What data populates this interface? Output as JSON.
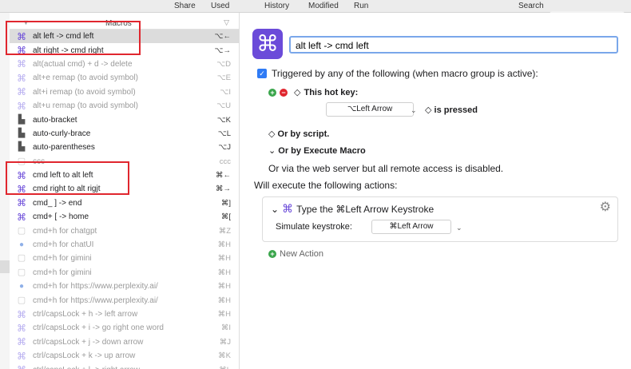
{
  "toolbar": {
    "share": "Share",
    "used": "Used",
    "history": "History",
    "modified": "Modified",
    "run": "Run",
    "search": "Search"
  },
  "macros": {
    "title": "Macros",
    "items": [
      {
        "name": "alt left -> cmd left",
        "key": "⌥←",
        "icon": "keyboard-maestro-icon",
        "dim": false,
        "selected": true
      },
      {
        "name": "alt right -> cmd right",
        "key": "⌥→",
        "icon": "keyboard-maestro-icon",
        "dim": false,
        "selected": false
      },
      {
        "name": "alt(actual cmd) + d -> delete",
        "key": "⌥D",
        "icon": "keyboard-maestro-icon",
        "dim": true,
        "selected": false
      },
      {
        "name": "alt+e remap (to avoid symbol)",
        "key": "⌥E",
        "icon": "keyboard-maestro-icon",
        "dim": true,
        "selected": false
      },
      {
        "name": "alt+i remap (to avoid symbol)",
        "key": "⌥I",
        "icon": "keyboard-maestro-icon",
        "dim": true,
        "selected": false
      },
      {
        "name": "alt+u remap (to avoid symbol)",
        "key": "⌥U",
        "icon": "keyboard-maestro-icon",
        "dim": true,
        "selected": false
      },
      {
        "name": "auto-bracket",
        "key": "⌥K",
        "icon": "app-icon",
        "dim": false,
        "selected": false
      },
      {
        "name": "auto-curly-brace",
        "key": "⌥L",
        "icon": "app-icon",
        "dim": false,
        "selected": false
      },
      {
        "name": "auto-parentheses",
        "key": "⌥J",
        "icon": "app-icon",
        "dim": false,
        "selected": false
      },
      {
        "name": "ccc",
        "key": "ccc",
        "icon": "grey-icon",
        "dim": true,
        "selected": false
      },
      {
        "name": "cmd left to alt left",
        "key": "⌘←",
        "icon": "keyboard-maestro-icon",
        "dim": false,
        "selected": false
      },
      {
        "name": "cmd right to alt rigjt",
        "key": "⌘→",
        "icon": "keyboard-maestro-icon",
        "dim": false,
        "selected": false
      },
      {
        "name": "cmd_ ] -> end",
        "key": "⌘]",
        "icon": "keyboard-maestro-icon",
        "dim": false,
        "selected": false
      },
      {
        "name": "cmd+ [ -> home",
        "key": "⌘[",
        "icon": "keyboard-maestro-icon",
        "dim": false,
        "selected": false
      },
      {
        "name": "cmd+h for chatgpt",
        "key": "⌘Z",
        "icon": "grey-icon",
        "dim": true,
        "selected": false
      },
      {
        "name": "cmd+h for chatUI",
        "key": "⌘H",
        "icon": "chat-icon",
        "dim": true,
        "selected": false
      },
      {
        "name": "cmd+h for gimini",
        "key": "⌘H",
        "icon": "grey-icon",
        "dim": true,
        "selected": false
      },
      {
        "name": "cmd+h for gimini",
        "key": "⌘H",
        "icon": "grey-icon",
        "dim": true,
        "selected": false
      },
      {
        "name": "cmd+h for https://www.perplexity.ai/",
        "key": "⌘H",
        "icon": "chat-icon",
        "dim": true,
        "selected": false
      },
      {
        "name": "cmd+h for https://www.perplexity.ai/",
        "key": "⌘H",
        "icon": "grey-icon",
        "dim": true,
        "selected": false
      },
      {
        "name": "ctrl/capsLock + h -> left arrow",
        "key": "⌘H",
        "icon": "keyboard-maestro-icon",
        "dim": true,
        "selected": false
      },
      {
        "name": "ctrl/capsLock + i -> go right one word",
        "key": "⌘I",
        "icon": "keyboard-maestro-icon",
        "dim": true,
        "selected": false
      },
      {
        "name": "ctrl/capsLock + j -> down arrow",
        "key": "⌘J",
        "icon": "keyboard-maestro-icon",
        "dim": true,
        "selected": false
      },
      {
        "name": "ctrl/capsLock + k -> up arrow",
        "key": "⌘K",
        "icon": "keyboard-maestro-icon",
        "dim": true,
        "selected": false
      },
      {
        "name": "ctrl/capsLock + l -> right arrow",
        "key": "⌘L",
        "icon": "keyboard-maestro-icon",
        "dim": true,
        "selected": false
      }
    ]
  },
  "editor": {
    "macro_name": "alt left -> cmd left",
    "triggered_text": "Triggered by any of the following (when macro group is active):",
    "hotkey_label": "This hot key:",
    "hotkey_value": "⌥Left Arrow",
    "is_pressed": "is pressed",
    "or_by_script": "Or by script.",
    "or_by_execute": "Or by Execute Macro",
    "web_server_text": "Or via the web server but all remote access is disabled.",
    "will_execute": "Will execute the following actions:",
    "action_title": "Type the ⌘Left Arrow Keystroke",
    "simulate_label": "Simulate keystroke:",
    "simulate_value": "⌘Left Arrow",
    "new_action": "New Action"
  },
  "colors": {
    "accent": "#6b4bd9",
    "highlight_box": "#e0262e",
    "checkbox": "#2f7bf5",
    "focus_ring": "#7aa7ea"
  }
}
